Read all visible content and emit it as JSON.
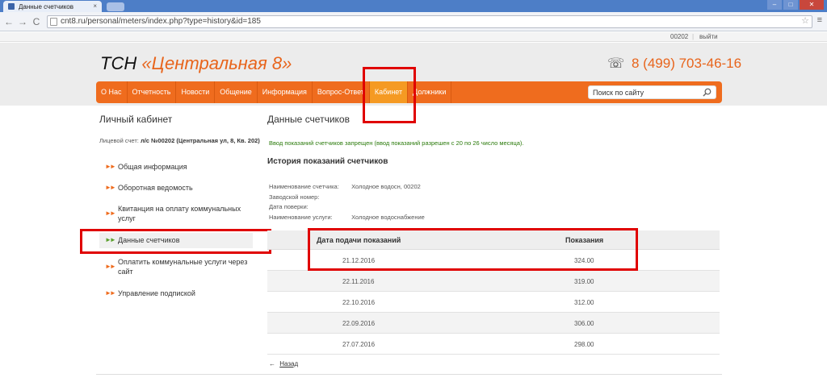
{
  "browser": {
    "tab_title": "Данные счетчиков",
    "tab_close": "×",
    "url": "cnt8.ru/personal/meters/index.php?type=history&id=185",
    "back": "←",
    "forward": "→",
    "reload": "C",
    "star": "☆",
    "wrench": "≡",
    "window_controls": [
      "–",
      "□",
      "✕"
    ]
  },
  "topbar": {
    "account": "00202",
    "separator": "|",
    "logout": "выйти"
  },
  "header": {
    "logo_prefix": "ТСН",
    "logo_name": "«Центральная 8»",
    "phone": "8 (499) 703-46-16",
    "phone_icon": "☏"
  },
  "nav": {
    "items": [
      {
        "label": "О Нас"
      },
      {
        "label": "Отчетность"
      },
      {
        "label": "Новости"
      },
      {
        "label": "Общение"
      },
      {
        "label": "Информация"
      },
      {
        "label": "Вопрос-Ответ"
      },
      {
        "label": "Кабинет",
        "active": true
      },
      {
        "label": "Должники"
      }
    ],
    "search_placeholder": "Поиск по сайту"
  },
  "sidebar": {
    "title": "Личный кабинет",
    "account_label": "Лицевой счет:",
    "account_value": "л/с №00202 (Центральная ул, 8, Кв. 202)",
    "arrow": "►►",
    "items": [
      {
        "label": "Общая информация"
      },
      {
        "label": "Оборотная ведомость"
      },
      {
        "label": "Квитанция на оплату коммунальных услуг"
      },
      {
        "label": "Данные счетчиков",
        "active": true
      },
      {
        "label": "Оплатить коммунальные услуги через сайт"
      },
      {
        "label": "Управление подпиской"
      }
    ]
  },
  "content": {
    "title": "Данные счетчиков",
    "notice": "Ввод показаний счетчиков запрещен (ввод показаний разрешен с 20 по 26 число месяца).",
    "subtitle": "История показаний счетчиков",
    "info": [
      {
        "label": "Наименование счетчика:",
        "value": "Холодное водосн, 00202"
      },
      {
        "label": "Заводской номер:",
        "value": ""
      },
      {
        "label": "Дата поверки:",
        "value": ""
      },
      {
        "label": "Наименование услуги:",
        "value": "Холодное водоснабжение"
      }
    ],
    "table": {
      "headers": {
        "date": "Дата подачи показаний",
        "value": "Показания"
      },
      "rows": [
        {
          "date": "21.12.2016",
          "value": "324.00"
        },
        {
          "date": "22.11.2016",
          "value": "319.00"
        },
        {
          "date": "22.10.2016",
          "value": "312.00"
        },
        {
          "date": "22.09.2016",
          "value": "306.00"
        },
        {
          "date": "27.07.2016",
          "value": "298.00"
        }
      ]
    },
    "back_arrow": "←",
    "back_label": "Назад"
  },
  "colors": {
    "accent": "#ef6c1e",
    "nav_active": "#f59a23",
    "highlight_box": "#e00000",
    "notice_green": "#2a7a0a"
  }
}
